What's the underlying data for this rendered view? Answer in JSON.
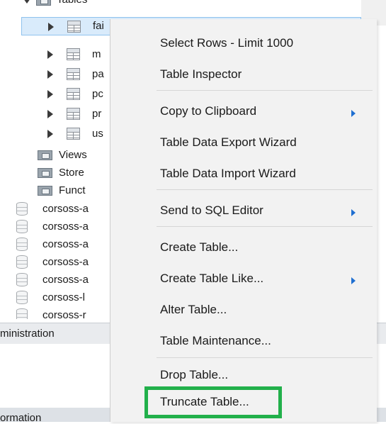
{
  "tree": {
    "tables_node": "Tables",
    "table_rows": [
      "fai",
      "m",
      "pa",
      "pc",
      "pr",
      "us"
    ],
    "folders": [
      "Views",
      "Store",
      "Funct"
    ],
    "schemas": [
      "corsoss-a",
      "corsoss-a",
      "corsoss-a",
      "corsoss-a",
      "corsoss-a",
      "corsoss-l",
      "corsoss-r"
    ]
  },
  "bottom": {
    "administration_tab": "ministration",
    "information_panel": "ormation"
  },
  "context_menu": {
    "items": [
      {
        "label": "Select Rows - Limit 1000",
        "submenu": false
      },
      {
        "label": "Table Inspector",
        "submenu": false
      },
      {
        "label": "Copy to Clipboard",
        "submenu": true
      },
      {
        "label": "Table Data Export Wizard",
        "submenu": false
      },
      {
        "label": "Table Data Import Wizard",
        "submenu": false
      },
      {
        "label": "Send to SQL Editor",
        "submenu": true
      },
      {
        "label": "Create Table...",
        "submenu": false
      },
      {
        "label": "Create Table Like...",
        "submenu": true
      },
      {
        "label": "Alter Table...",
        "submenu": false
      },
      {
        "label": "Table Maintenance...",
        "submenu": false
      },
      {
        "label": "Drop Table...",
        "submenu": false
      },
      {
        "label": "Truncate Table...",
        "submenu": false
      }
    ],
    "highlight_color": "#22b04b",
    "submenu_arrow_color": "#1f6fd1"
  }
}
